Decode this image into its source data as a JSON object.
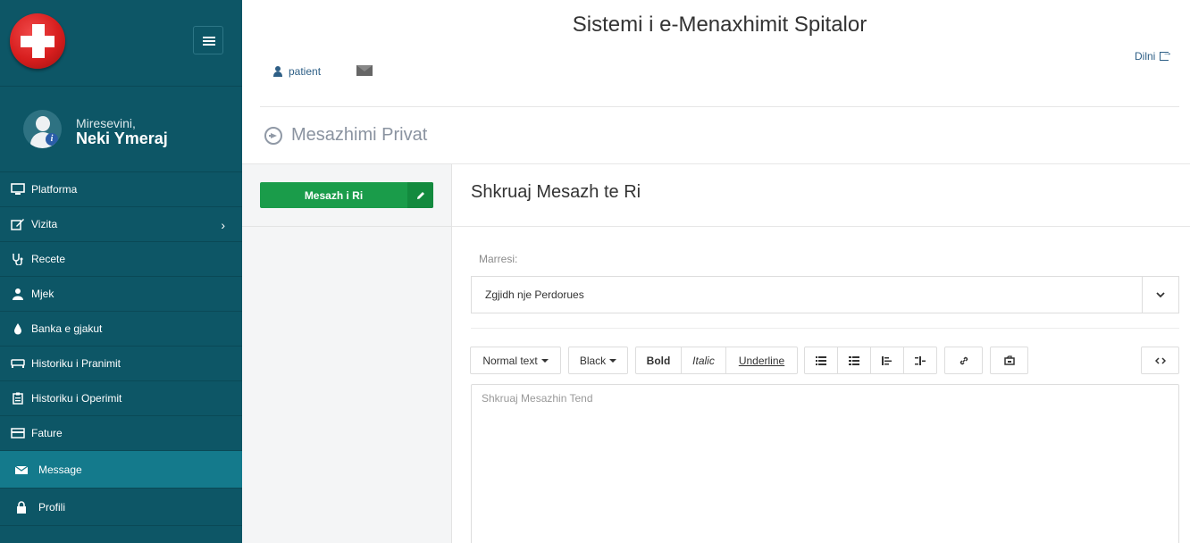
{
  "app": {
    "title": "Sistemi i e-Menaxhimit Spitalor"
  },
  "header": {
    "user_role": "patient",
    "logout_label": "Dilni"
  },
  "sidebar": {
    "welcome": "Miresevini,",
    "username": "Neki Ymeraj",
    "items": [
      {
        "label": "Platforma",
        "icon": "monitor-icon"
      },
      {
        "label": "Vizita",
        "icon": "edit-icon"
      },
      {
        "label": "Recete",
        "icon": "stethoscope-icon"
      },
      {
        "label": "Mjek",
        "icon": "doctor-icon"
      },
      {
        "label": "Banka e gjakut",
        "icon": "blood-drop-icon"
      },
      {
        "label": "Historiku i Pranimit",
        "icon": "hospital-bed-icon"
      },
      {
        "label": "Historiku i Operimit",
        "icon": "clipboard-icon"
      },
      {
        "label": "Fature",
        "icon": "credit-card-icon"
      },
      {
        "label": "Message",
        "icon": "envelope-icon"
      },
      {
        "label": "Profili",
        "icon": "lock-icon"
      }
    ]
  },
  "page": {
    "heading": "Mesazhimi Privat"
  },
  "left_panel": {
    "new_message_label": "Mesazh i Ri"
  },
  "compose": {
    "title": "Shkruaj Mesazh te Ri",
    "recipient_label": "Marresi:",
    "recipient_value": "Zgjidh nje Perdorues",
    "editor_placeholder": "Shkruaj Mesazhin Tend"
  },
  "toolbar": {
    "text_style": "Normal text",
    "color": "Black",
    "bold": "Bold",
    "italic": "Italic",
    "underline": "Underline"
  },
  "colors": {
    "sidebar_bg": "#0d5666",
    "sidebar_active": "#147a8c",
    "primary_button": "#1a9c4a"
  }
}
